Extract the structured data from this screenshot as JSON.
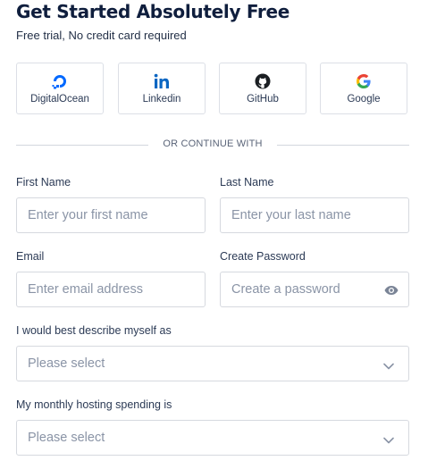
{
  "header": {
    "title": "Get Started Absolutely Free",
    "subtitle": "Free trial, No credit card required"
  },
  "providers": [
    {
      "label": "DigitalOcean",
      "icon": "digitalocean-icon",
      "color": "#0069ff"
    },
    {
      "label": "Linkedin",
      "icon": "linkedin-icon",
      "color": "#0a66c2"
    },
    {
      "label": "GitHub",
      "icon": "github-icon",
      "color": "#1b1f23"
    },
    {
      "label": "Google",
      "icon": "google-icon",
      "color": "#4285f4"
    }
  ],
  "divider": {
    "text": "OR CONTINUE WITH"
  },
  "form": {
    "first_name": {
      "label": "First Name",
      "placeholder": "Enter your first name",
      "value": ""
    },
    "last_name": {
      "label": "Last Name",
      "placeholder": "Enter your last name",
      "value": ""
    },
    "email": {
      "label": "Email",
      "placeholder": "Enter email address",
      "value": ""
    },
    "password": {
      "label": "Create Password",
      "placeholder": "Create a password",
      "value": ""
    },
    "describe": {
      "label": "I would best describe myself as",
      "selected": "Please select"
    },
    "spending": {
      "label": "My monthly hosting spending is",
      "selected": "Please select"
    }
  },
  "colors": {
    "title": "#0f1e3d",
    "border": "#d6d9df",
    "placeholder": "#8a94a6"
  }
}
